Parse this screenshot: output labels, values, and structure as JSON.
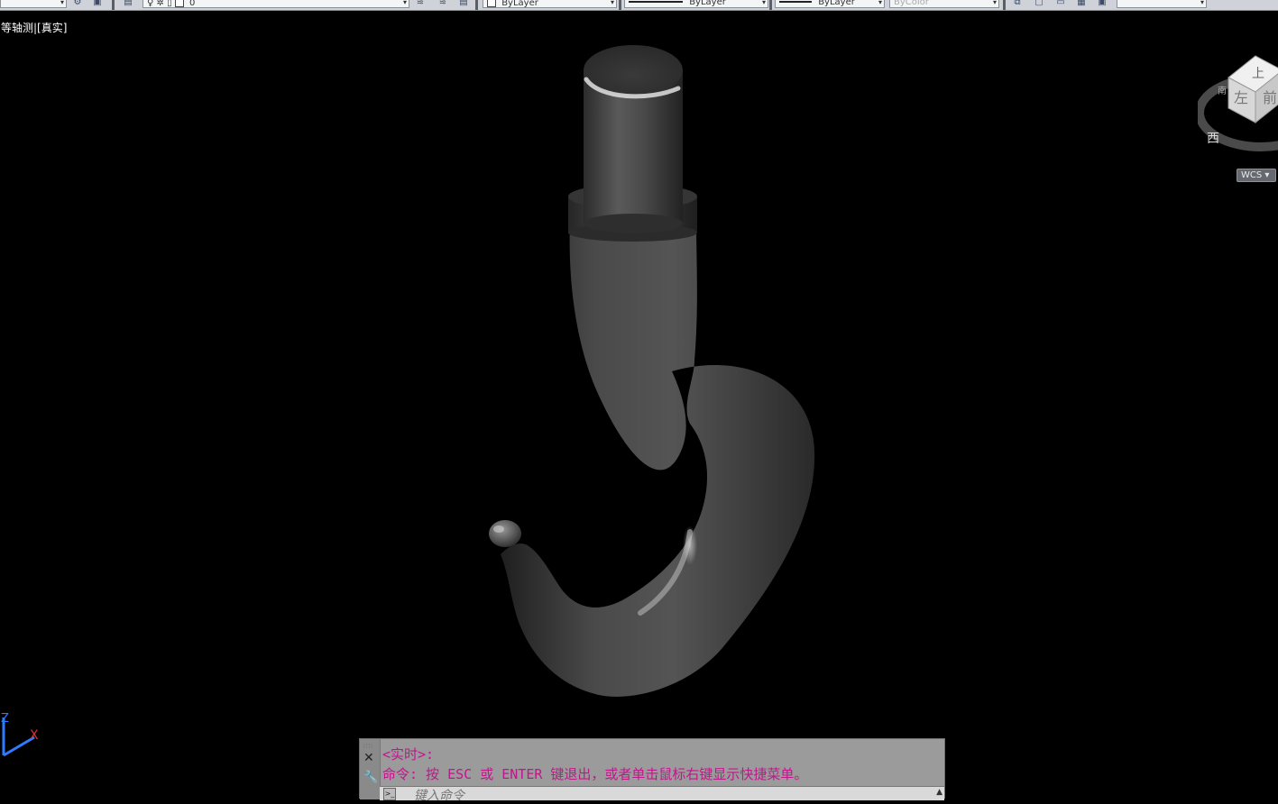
{
  "toolbar": {
    "layer_value": "0",
    "color_value": "ByLayer",
    "linetype_value": "ByLayer",
    "lineweight_value": "ByLayer",
    "plotstyle_value": "ByColor"
  },
  "viewport": {
    "label": "等轴测|[真实]"
  },
  "viewcube": {
    "top_face": "上",
    "front_face": "前",
    "left_face": "左",
    "compass_west": "西",
    "compass_south": "南",
    "wcs_label": "WCS"
  },
  "ucs": {
    "z_label": "Z",
    "x_label": "X"
  },
  "command": {
    "history_line1": "<实时>:",
    "history_line2": "命令:  按 ESC 或 ENTER 键退出，或者单击鼠标右键显示快捷菜单。",
    "placeholder": "键入命令"
  },
  "colors": {
    "background": "#000000",
    "command_text": "#c0168c",
    "toolbar_bg": "#cfd3d9"
  }
}
